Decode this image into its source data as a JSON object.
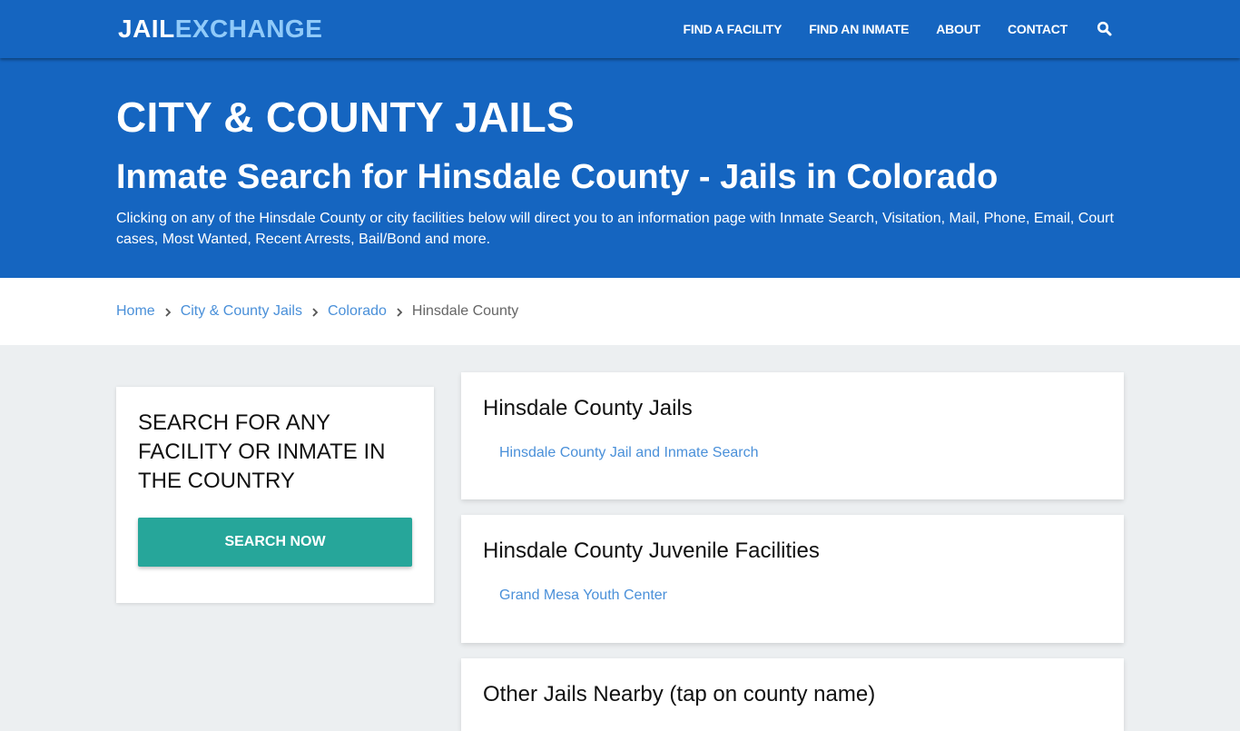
{
  "navbar": {
    "logo_part1": "JAIL",
    "logo_part2": "EXCHANGE",
    "links": [
      "FIND A FACILITY",
      "FIND AN INMATE",
      "ABOUT",
      "CONTACT"
    ],
    "search_icon": "search-icon"
  },
  "hero": {
    "title": "CITY & COUNTY JAILS",
    "subtitle": "Inmate Search for Hinsdale County - Jails in Colorado",
    "description": "Clicking on any of the Hinsdale County or city facilities below will direct you to an information page with Inmate Search, Visitation, Mail, Phone, Email, Court cases, Most Wanted, Recent Arrests, Bail/Bond and more."
  },
  "breadcrumb": {
    "items": [
      "Home",
      "City & County Jails",
      "Colorado"
    ],
    "current": "Hinsdale County"
  },
  "sidebar": {
    "heading": "SEARCH FOR ANY FACILITY OR INMATE IN THE COUNTRY",
    "button_label": "SEARCH NOW"
  },
  "sections": [
    {
      "title": "Hinsdale County Jails",
      "links": [
        "Hinsdale County Jail and Inmate Search"
      ]
    },
    {
      "title": "Hinsdale County Juvenile Facilities",
      "links": [
        "Grand Mesa Youth Center"
      ]
    },
    {
      "title": "Other Jails Nearby (tap on county name)",
      "links": []
    }
  ],
  "colors": {
    "primary": "#1565c0",
    "logo_accent": "#90caf9",
    "button": "#26a69a",
    "link": "#4a90d9",
    "background": "#eceff1"
  }
}
